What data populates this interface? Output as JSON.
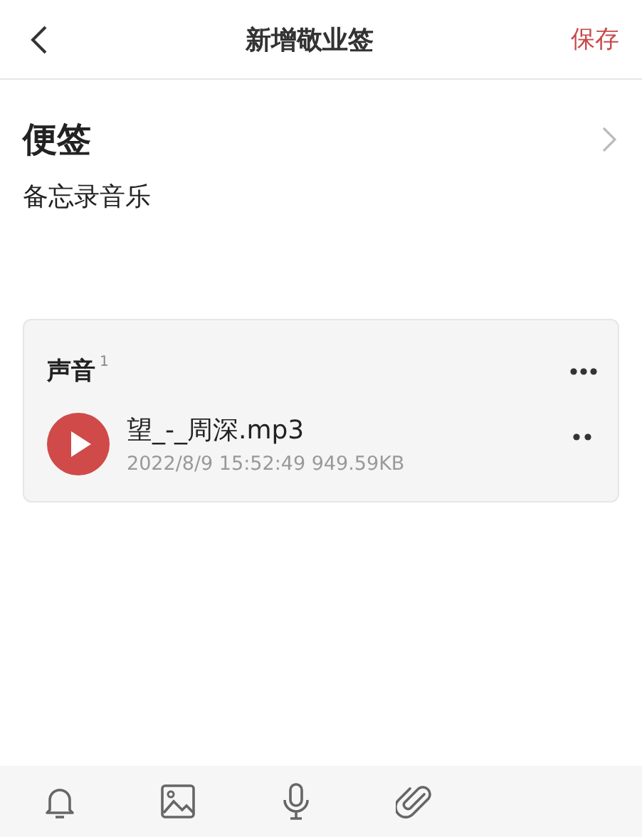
{
  "header": {
    "title": "新增敬业签",
    "action": "保存"
  },
  "note": {
    "category": "便签",
    "text": "备忘录音乐"
  },
  "sound_card": {
    "title": "声音",
    "count": "1",
    "files": [
      {
        "name": "望_-_周深.mp3",
        "meta": "2022/8/9 15:52:49 949.59KB"
      }
    ]
  },
  "toolbar": [
    {
      "kind": "bell"
    },
    {
      "kind": "image"
    },
    {
      "kind": "mic"
    },
    {
      "kind": "clip"
    }
  ]
}
